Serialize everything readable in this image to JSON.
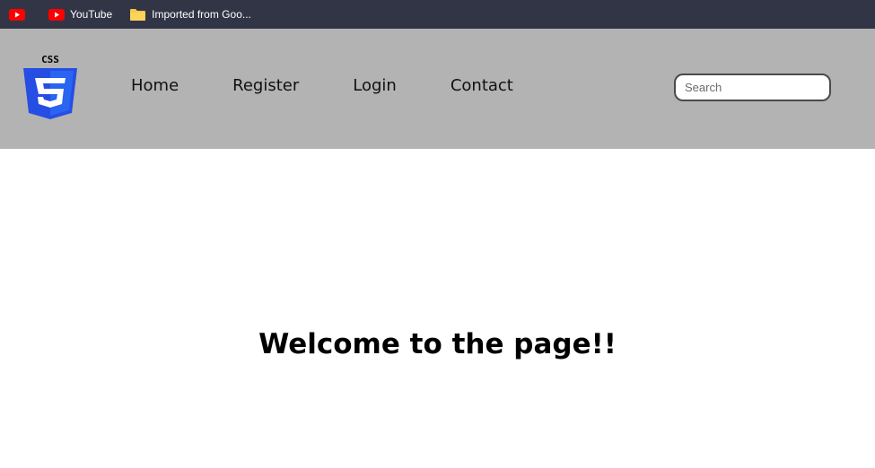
{
  "bookmarks": [
    {
      "label": "",
      "icon": "youtube-icon"
    },
    {
      "label": "YouTube",
      "icon": "youtube-icon"
    },
    {
      "label": "Imported from Goo...",
      "icon": "folder-icon"
    }
  ],
  "logo": {
    "text": "CSS",
    "icon": "css3-logo-icon",
    "color": "#264de4"
  },
  "nav": {
    "links": [
      "Home",
      "Register",
      "Login",
      "Contact"
    ]
  },
  "search": {
    "placeholder": "Search",
    "value": ""
  },
  "main": {
    "heading": "Welcome to the page!!"
  },
  "colors": {
    "bookmarks_bar": "#323546",
    "navbar": "#b3b3b3",
    "youtube_red": "#ff0000",
    "folder_yellow": "#f7c948"
  }
}
